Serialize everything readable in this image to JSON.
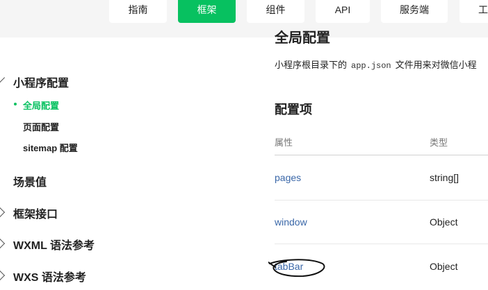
{
  "nav": {
    "tabs": [
      {
        "label": "指南",
        "active": false
      },
      {
        "label": "框架",
        "active": true
      },
      {
        "label": "组件",
        "active": false
      },
      {
        "label": "API",
        "active": false
      },
      {
        "label": "服务端",
        "active": false
      },
      {
        "label": "工",
        "active": false
      }
    ],
    "accent_color": "#07c160"
  },
  "sidebar": {
    "sections": [
      {
        "label": "小程序配置",
        "expanded": true
      },
      {
        "label": "场景值"
      },
      {
        "label": "框架接口",
        "expanded": false
      },
      {
        "label": "WXML 语法参考",
        "expanded": false
      },
      {
        "label": "WXS 语法参考",
        "expanded": false
      }
    ],
    "sub_items": [
      {
        "label": "全局配置",
        "active": true
      },
      {
        "label": "页面配置",
        "active": false
      },
      {
        "label": "sitemap 配置",
        "active": false
      }
    ]
  },
  "main": {
    "partial_title": "全局配置",
    "intro_before": "小程序根目录下的",
    "intro_code": "app.json",
    "intro_after": "文件用来对微信小程",
    "section_title": "配置项",
    "table": {
      "headers": [
        "属性",
        "类型"
      ],
      "rows": [
        {
          "attr": "pages",
          "type": "string[]"
        },
        {
          "attr": "window",
          "type": "Object"
        },
        {
          "attr": "tabBar",
          "type": "Object"
        }
      ]
    },
    "link_color": "#3a67a8"
  }
}
